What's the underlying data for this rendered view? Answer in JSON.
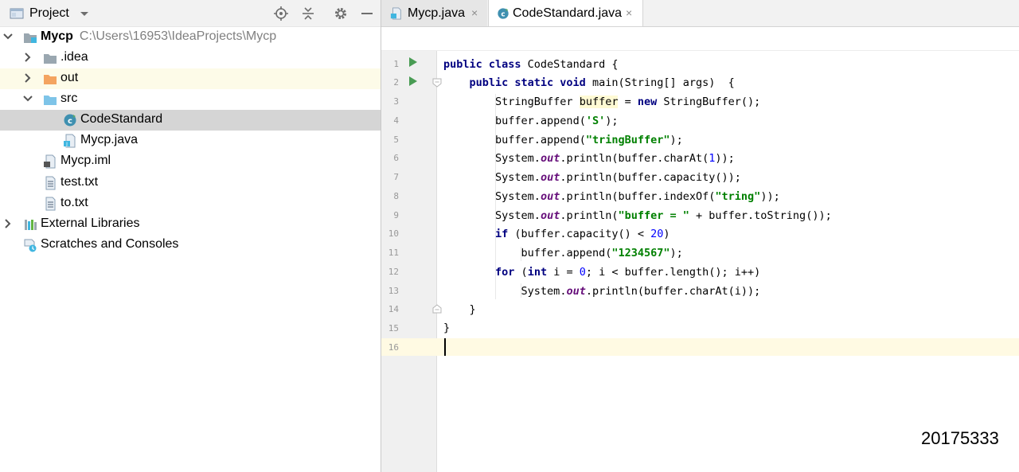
{
  "project_pane": {
    "title": "Project",
    "icons": [
      "project-view-icon",
      "dropdown-arrow-icon",
      "locate-icon",
      "collapse-all-icon",
      "settings-gear-icon",
      "hide-icon"
    ],
    "tree": [
      {
        "label": "Mycp",
        "path": "C:\\Users\\16953\\IdeaProjects\\Mycp",
        "icon": "module-folder-icon",
        "expanded": true
      },
      {
        "label": ".idea",
        "icon": "folder-icon",
        "expanded": false
      },
      {
        "label": "out",
        "icon": "excluded-folder-icon",
        "expanded": false
      },
      {
        "label": "src",
        "icon": "source-folder-icon",
        "expanded": true
      },
      {
        "label": "CodeStandard",
        "icon": "java-class-icon",
        "selected": true
      },
      {
        "label": "Mycp.java",
        "icon": "java-file-icon"
      },
      {
        "label": "Mycp.iml",
        "icon": "iml-file-icon"
      },
      {
        "label": "test.txt",
        "icon": "text-file-icon"
      },
      {
        "label": "to.txt",
        "icon": "text-file-icon"
      },
      {
        "label": "External Libraries",
        "icon": "libraries-icon",
        "expanded": false
      },
      {
        "label": "Scratches and Consoles",
        "icon": "scratches-icon"
      }
    ]
  },
  "editor": {
    "tabs": [
      {
        "label": "Mycp.java",
        "icon": "java-file-icon",
        "active": false
      },
      {
        "label": "CodeStandard.java",
        "icon": "java-class-icon",
        "active": true
      }
    ],
    "close_glyph": "×",
    "line_numbers": [
      "1",
      "2",
      "3",
      "4",
      "5",
      "6",
      "7",
      "8",
      "9",
      "10",
      "11",
      "12",
      "13",
      "14",
      "15",
      "16"
    ],
    "code": {
      "l1_kw": "public class",
      "l1_rest": " CodeStandard {",
      "l2_kw": "public static void",
      "l2_rest": " main(String[] args)  {",
      "l3_a": "StringBuffer ",
      "l3_var": "buffer",
      "l3_b": " = ",
      "l3_kw": "new",
      "l3_c": " StringBuffer();",
      "l4_a": "buffer.append(",
      "l4_str": "'S'",
      "l4_b": ");",
      "l5_a": "buffer.append(",
      "l5_str": "\"tringBuffer\"",
      "l5_b": ");",
      "l6_a": "System.",
      "l6_fld": "out",
      "l6_b": ".println(buffer.charAt(",
      "l6_num": "1",
      "l6_c": "));",
      "l7_a": "System.",
      "l7_fld": "out",
      "l7_b": ".println(buffer.capacity());",
      "l8_a": "System.",
      "l8_fld": "out",
      "l8_b": ".println(buffer.indexOf(",
      "l8_str": "\"tring\"",
      "l8_c": "));",
      "l9_a": "System.",
      "l9_fld": "out",
      "l9_b": ".println(",
      "l9_str": "\"buffer = \"",
      "l9_c": " + buffer.toString());",
      "l10_kw": "if",
      "l10_a": " (buffer.capacity() < ",
      "l10_num": "20",
      "l10_b": ")",
      "l11_a": "buffer.append(",
      "l11_str": "\"1234567\"",
      "l11_b": ");",
      "l12_kw": "for",
      "l12_a": " (",
      "l12_kw2": "int",
      "l12_b": " i = ",
      "l12_num": "0",
      "l12_c": "; i < buffer.length(); i++)",
      "l13_a": "System.",
      "l13_fld": "out",
      "l13_b": ".println(buffer.charAt(i));",
      "l14": "}",
      "l15": "}"
    }
  },
  "watermark": "20175333",
  "colors": {
    "keyword": "#000080",
    "string": "#008000",
    "number": "#0000ff",
    "field": "#660e7a",
    "selection_row": "#d5d5d5",
    "out_row": "#fdfbe8",
    "current_line": "#fffae3"
  }
}
